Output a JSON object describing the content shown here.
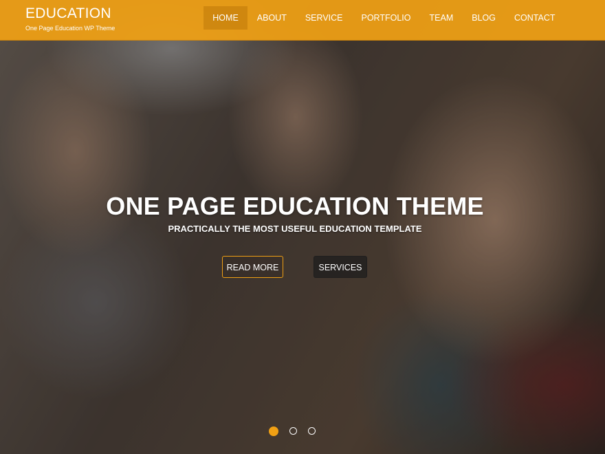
{
  "header": {
    "title": "EDUCATION",
    "tagline": "One Page Education WP Theme",
    "background_color": "#f0a014"
  },
  "nav": {
    "items": [
      {
        "label": "HOME",
        "active": true
      },
      {
        "label": "ABOUT",
        "active": false
      },
      {
        "label": "SERVICE",
        "active": false
      },
      {
        "label": "PORTFOLIO",
        "active": false
      },
      {
        "label": "TEAM",
        "active": false
      },
      {
        "label": "BLOG",
        "active": false
      },
      {
        "label": "CONTACT",
        "active": false
      }
    ]
  },
  "hero": {
    "title": "ONE PAGE EDUCATION THEME",
    "subtitle": "PRACTICALLY THE MOST USEFUL EDUCATION TEMPLATE",
    "read_more_label": "READ MORE",
    "services_label": "SERVICES",
    "accent_color": "#f0a014"
  },
  "slider": {
    "total_slides": 3,
    "active_slide": 1
  }
}
